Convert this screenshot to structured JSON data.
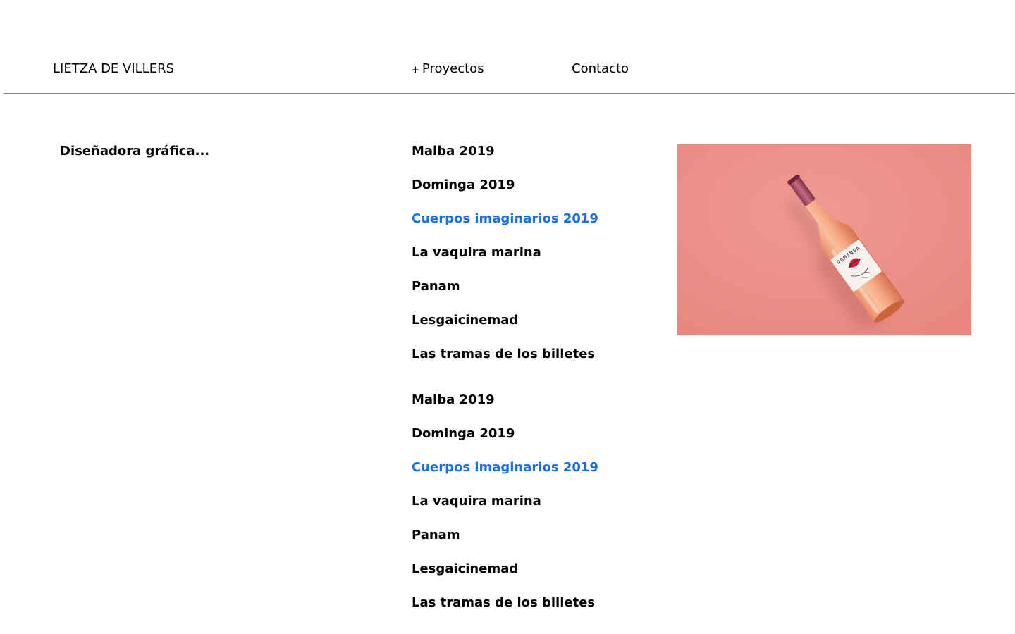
{
  "colors": {
    "background": "#ffffff",
    "text": "#000000",
    "accent": "#1a6ee8",
    "divider": "#888888",
    "preview_bg": "#eb8c85"
  },
  "header": {
    "logo": "LIETZA DE VILLERS",
    "nav": {
      "projects_prefix": "+",
      "projects_label": "Proyectos",
      "contact_label": "Contacto"
    }
  },
  "intro": {
    "tagline": "Diseñadora gráfica..."
  },
  "projects_primary": [
    {
      "label": "Malba 2019",
      "active": false
    },
    {
      "label": "Dominga 2019",
      "active": false
    },
    {
      "label": "Cuerpos imaginarios 2019",
      "active": true
    },
    {
      "label": "La vaquira marina",
      "active": false
    },
    {
      "label": "Panam",
      "active": false
    },
    {
      "label": "Lesgaicinemad",
      "active": false
    },
    {
      "label": "Las tramas de los billetes",
      "active": false
    }
  ],
  "projects_secondary": [
    {
      "label": "Malba 2019",
      "active": false
    },
    {
      "label": "Dominga 2019",
      "active": false
    },
    {
      "label": "Cuerpos imaginarios 2019",
      "active": true
    },
    {
      "label": "La vaquira marina",
      "active": false
    },
    {
      "label": "Panam",
      "active": false
    },
    {
      "label": "Lesgaicinemad",
      "active": false
    },
    {
      "label": "Las tramas de los billetes",
      "active": false
    }
  ],
  "preview": {
    "bottle_label": "DOMINGA"
  }
}
